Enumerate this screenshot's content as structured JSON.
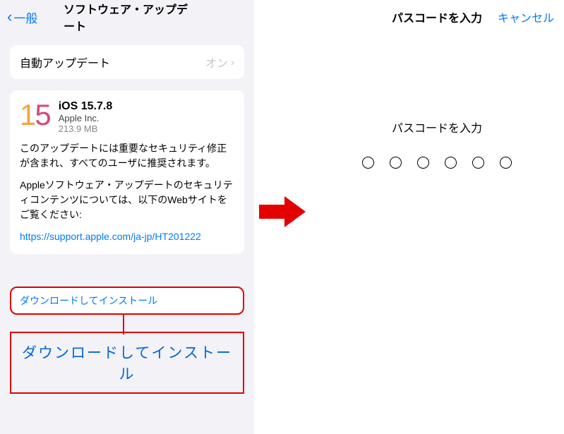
{
  "left": {
    "back": "一般",
    "title": "ソフトウェア・アップデート",
    "auto_update": {
      "label": "自動アップデート",
      "value": "オン"
    },
    "update": {
      "name": "iOS 15.7.8",
      "publisher": "Apple Inc.",
      "size": "213.9 MB",
      "desc1": "このアップデートには重要なセキュリティ修正が含まれ、すべてのユーザに推奨されます。",
      "desc2": "Appleソフトウェア・アップデートのセキュリティコンテンツについては、以下のWebサイトをご覧ください:",
      "link": "https://support.apple.com/ja-jp/HT201222"
    },
    "download_btn": "ダウンロードしてインストール",
    "callout": "ダウンロードしてインストール"
  },
  "right": {
    "title": "パスコードを入力",
    "cancel": "キャンセル",
    "prompt": "パスコードを入力"
  }
}
